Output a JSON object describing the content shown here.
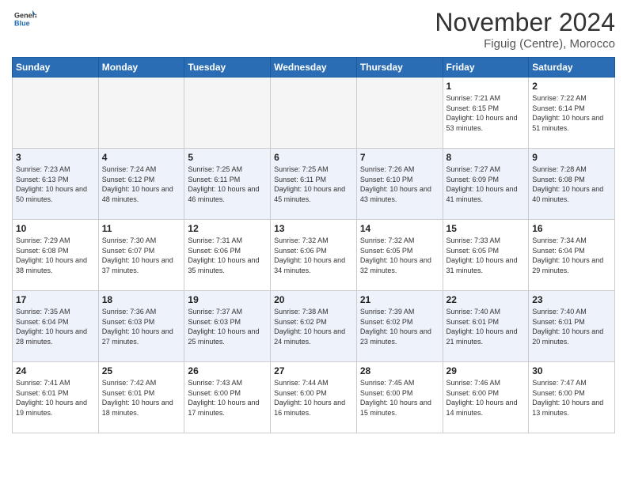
{
  "header": {
    "logo_general": "General",
    "logo_blue": "Blue",
    "month_title": "November 2024",
    "subtitle": "Figuig (Centre), Morocco"
  },
  "weekdays": [
    "Sunday",
    "Monday",
    "Tuesday",
    "Wednesday",
    "Thursday",
    "Friday",
    "Saturday"
  ],
  "weeks": [
    [
      {
        "day": "",
        "empty": true
      },
      {
        "day": "",
        "empty": true
      },
      {
        "day": "",
        "empty": true
      },
      {
        "day": "",
        "empty": true
      },
      {
        "day": "",
        "empty": true
      },
      {
        "day": "1",
        "sunrise": "7:21 AM",
        "sunset": "6:15 PM",
        "daylight": "10 hours and 53 minutes."
      },
      {
        "day": "2",
        "sunrise": "7:22 AM",
        "sunset": "6:14 PM",
        "daylight": "10 hours and 51 minutes."
      }
    ],
    [
      {
        "day": "3",
        "sunrise": "7:23 AM",
        "sunset": "6:13 PM",
        "daylight": "10 hours and 50 minutes."
      },
      {
        "day": "4",
        "sunrise": "7:24 AM",
        "sunset": "6:12 PM",
        "daylight": "10 hours and 48 minutes."
      },
      {
        "day": "5",
        "sunrise": "7:25 AM",
        "sunset": "6:11 PM",
        "daylight": "10 hours and 46 minutes."
      },
      {
        "day": "6",
        "sunrise": "7:25 AM",
        "sunset": "6:11 PM",
        "daylight": "10 hours and 45 minutes."
      },
      {
        "day": "7",
        "sunrise": "7:26 AM",
        "sunset": "6:10 PM",
        "daylight": "10 hours and 43 minutes."
      },
      {
        "day": "8",
        "sunrise": "7:27 AM",
        "sunset": "6:09 PM",
        "daylight": "10 hours and 41 minutes."
      },
      {
        "day": "9",
        "sunrise": "7:28 AM",
        "sunset": "6:08 PM",
        "daylight": "10 hours and 40 minutes."
      }
    ],
    [
      {
        "day": "10",
        "sunrise": "7:29 AM",
        "sunset": "6:08 PM",
        "daylight": "10 hours and 38 minutes."
      },
      {
        "day": "11",
        "sunrise": "7:30 AM",
        "sunset": "6:07 PM",
        "daylight": "10 hours and 37 minutes."
      },
      {
        "day": "12",
        "sunrise": "7:31 AM",
        "sunset": "6:06 PM",
        "daylight": "10 hours and 35 minutes."
      },
      {
        "day": "13",
        "sunrise": "7:32 AM",
        "sunset": "6:06 PM",
        "daylight": "10 hours and 34 minutes."
      },
      {
        "day": "14",
        "sunrise": "7:32 AM",
        "sunset": "6:05 PM",
        "daylight": "10 hours and 32 minutes."
      },
      {
        "day": "15",
        "sunrise": "7:33 AM",
        "sunset": "6:05 PM",
        "daylight": "10 hours and 31 minutes."
      },
      {
        "day": "16",
        "sunrise": "7:34 AM",
        "sunset": "6:04 PM",
        "daylight": "10 hours and 29 minutes."
      }
    ],
    [
      {
        "day": "17",
        "sunrise": "7:35 AM",
        "sunset": "6:04 PM",
        "daylight": "10 hours and 28 minutes."
      },
      {
        "day": "18",
        "sunrise": "7:36 AM",
        "sunset": "6:03 PM",
        "daylight": "10 hours and 27 minutes."
      },
      {
        "day": "19",
        "sunrise": "7:37 AM",
        "sunset": "6:03 PM",
        "daylight": "10 hours and 25 minutes."
      },
      {
        "day": "20",
        "sunrise": "7:38 AM",
        "sunset": "6:02 PM",
        "daylight": "10 hours and 24 minutes."
      },
      {
        "day": "21",
        "sunrise": "7:39 AM",
        "sunset": "6:02 PM",
        "daylight": "10 hours and 23 minutes."
      },
      {
        "day": "22",
        "sunrise": "7:40 AM",
        "sunset": "6:01 PM",
        "daylight": "10 hours and 21 minutes."
      },
      {
        "day": "23",
        "sunrise": "7:40 AM",
        "sunset": "6:01 PM",
        "daylight": "10 hours and 20 minutes."
      }
    ],
    [
      {
        "day": "24",
        "sunrise": "7:41 AM",
        "sunset": "6:01 PM",
        "daylight": "10 hours and 19 minutes."
      },
      {
        "day": "25",
        "sunrise": "7:42 AM",
        "sunset": "6:01 PM",
        "daylight": "10 hours and 18 minutes."
      },
      {
        "day": "26",
        "sunrise": "7:43 AM",
        "sunset": "6:00 PM",
        "daylight": "10 hours and 17 minutes."
      },
      {
        "day": "27",
        "sunrise": "7:44 AM",
        "sunset": "6:00 PM",
        "daylight": "10 hours and 16 minutes."
      },
      {
        "day": "28",
        "sunrise": "7:45 AM",
        "sunset": "6:00 PM",
        "daylight": "10 hours and 15 minutes."
      },
      {
        "day": "29",
        "sunrise": "7:46 AM",
        "sunset": "6:00 PM",
        "daylight": "10 hours and 14 minutes."
      },
      {
        "day": "30",
        "sunrise": "7:47 AM",
        "sunset": "6:00 PM",
        "daylight": "10 hours and 13 minutes."
      }
    ]
  ]
}
